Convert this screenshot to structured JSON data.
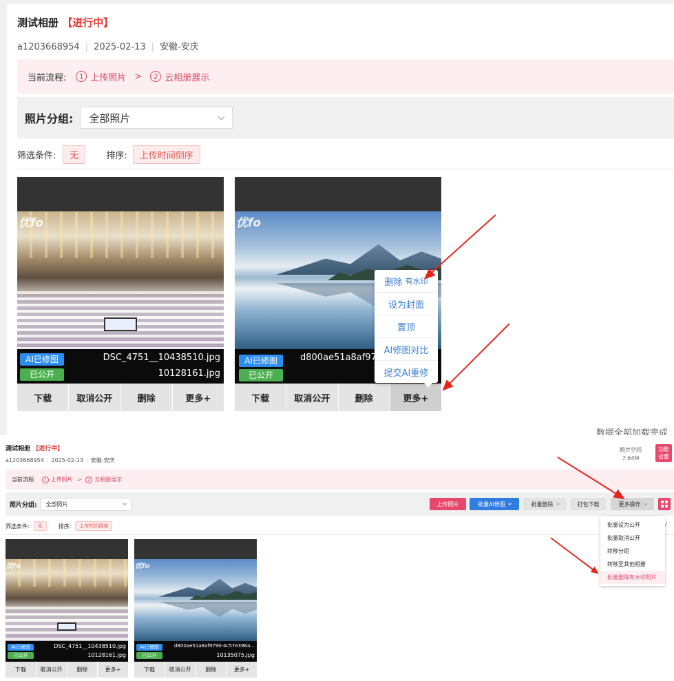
{
  "top": {
    "album_title": "测试相册",
    "status": "【进行中】",
    "meta": {
      "user": "a1203668954",
      "date": "2025-02-13",
      "location": "安徽-安庆"
    },
    "flow": {
      "label": "当前流程:",
      "step1_num": "1",
      "step1": "上传照片",
      "arrow": ">",
      "step2_num": "2",
      "step2": "云相册展示"
    },
    "group": {
      "label": "照片分组:",
      "value": "全部照片"
    },
    "filter": {
      "label": "筛选条件:",
      "value": "无",
      "sort_label": "排序:",
      "sort_value": "上传时间倒序"
    },
    "photos": [
      {
        "watermark": "优fo",
        "ai_badge": "AI已修图",
        "public_badge": "已公开",
        "filename_1": "DSC_4751__10438510.jpg",
        "filename_2": "10128161.jpg"
      },
      {
        "watermark": "优fo",
        "ai_badge": "AI已修图",
        "public_badge": "已公开",
        "filename_1": "d800ae51a8af979"
      }
    ],
    "actions": {
      "download": "下载",
      "unpublish": "取消公开",
      "delete": "删除",
      "more": "更多+"
    },
    "popup_menu": {
      "delete": "删除",
      "delete_note": "有水印",
      "set_cover": "设为封面",
      "pin": "置顶",
      "ai_compare": "AI修图对比",
      "ai_retouch": "提交AI重修"
    },
    "cut_text": "数据全部加载完成"
  },
  "bottom": {
    "album_title": "测试相册",
    "status": "【进行中】",
    "meta": {
      "user": "a1203668954",
      "date": "2025-02-13",
      "location": "安徽-安庆"
    },
    "space": {
      "label": "照片空间",
      "value": "7.64M"
    },
    "func_settings": "功能设置",
    "flow": {
      "label": "当前流程:",
      "step1_num": "1",
      "step1": "上传照片",
      "arrow": ">",
      "step2_num": "2",
      "step2": "云相册展示"
    },
    "group": {
      "label": "照片分组:",
      "value": "全部照片"
    },
    "toolbar": {
      "upload": "上传照片",
      "batch_ai": "批量AI修图",
      "batch_delete": "批量删除",
      "package_download": "打包下载",
      "more_ops": "更多操作"
    },
    "more_menu": [
      "批量设为公开",
      "批量取消公开",
      "转移分组",
      "转移至其他相册",
      "批量删除有水印照片"
    ],
    "filter": {
      "label": "筛选条件:",
      "value": "无",
      "sort_label": "排序:",
      "sort_value": "上传时间倒序"
    },
    "photos": [
      {
        "watermark": "优fo",
        "ai_badge": "AI已修图",
        "public_badge": "已公开",
        "filename_1": "DSC_4751__10438510.jpg",
        "filename_2": "10128161.jpg"
      },
      {
        "watermark": "优fo",
        "ai_badge": "AI已修图",
        "public_badge": "已公开",
        "filename_1": "d800ae51a8af9790-4c57e396a...",
        "filename_2": "10135075.jpg"
      }
    ],
    "actions": {
      "download": "下载",
      "unpublish": "取消公开",
      "delete": "删除",
      "more": "更多+"
    },
    "edge_char": "/"
  },
  "colors": {
    "accent": "#e9486e",
    "status_red": "#e53935",
    "ai_blue": "#2d8cf0",
    "public_green": "#4caf50",
    "annotation_red": "#e5261e"
  }
}
